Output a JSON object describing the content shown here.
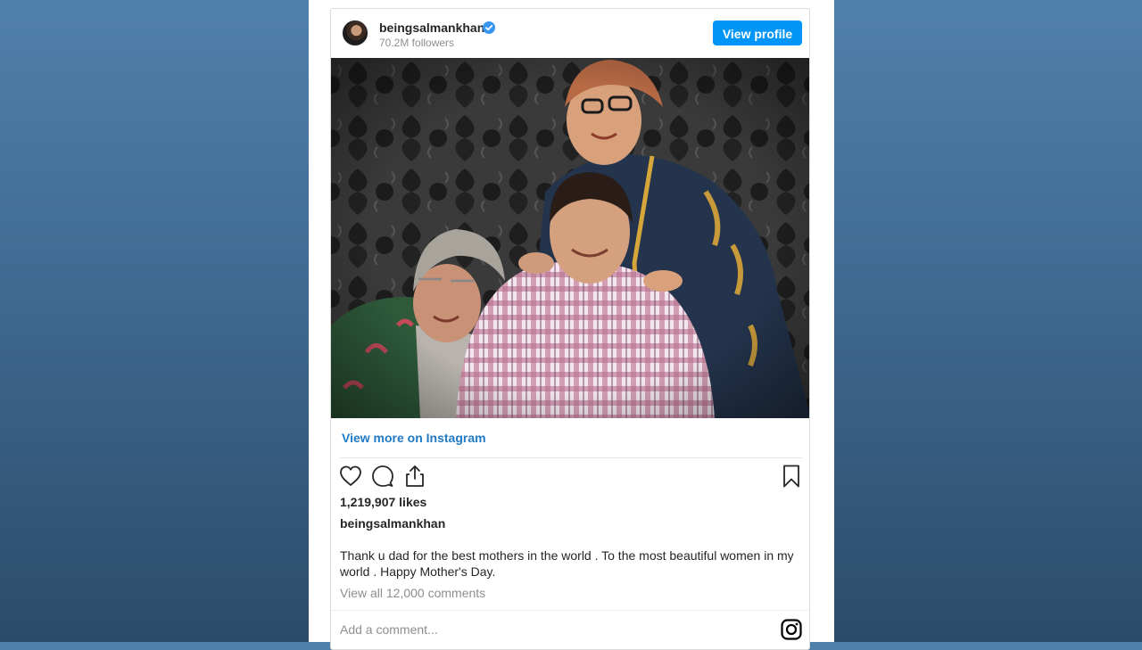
{
  "post": {
    "username": "beingsalmankhan",
    "followers": "70.2M followers",
    "view_profile_label": "View profile",
    "view_more_label": "View more on Instagram",
    "likes": "1,219,907 likes",
    "caption_username": "beingsalmankhan",
    "caption": "Thank u dad for the best mothers in the world . To the most beautiful women in my world . Happy Mother's Day.",
    "view_comments": "View all 12,000 comments",
    "add_comment_placeholder": "Add a comment..."
  },
  "icons": {
    "verified": "verified-badge-icon",
    "like": "heart-icon",
    "comment": "comment-bubble-icon",
    "share": "share-icon",
    "save": "bookmark-icon",
    "brand": "instagram-logo-icon"
  },
  "colors": {
    "accent": "#0095f6",
    "link": "#1f7ac6",
    "muted_text": "#8e8e8e",
    "backdrop": "#3f6a92"
  }
}
